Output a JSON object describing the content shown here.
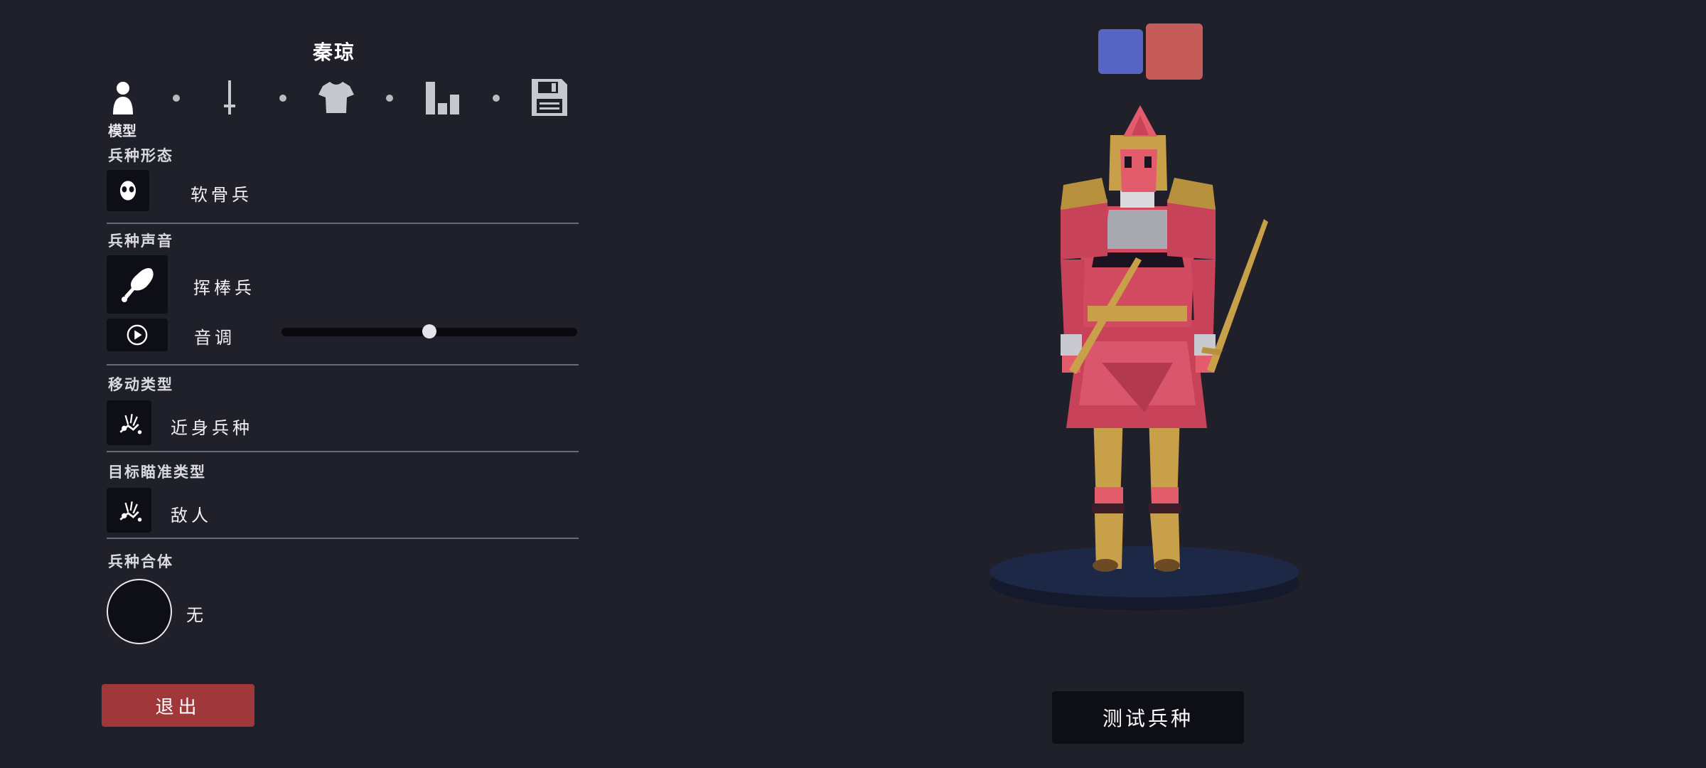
{
  "unit_name": "秦琼",
  "tabs": {
    "items": [
      {
        "name": "model",
        "icon": "person-icon",
        "active": true
      },
      {
        "name": "weapons",
        "icon": "sword-icon",
        "active": false
      },
      {
        "name": "clothing",
        "icon": "shirt-icon",
        "active": false
      },
      {
        "name": "stats",
        "icon": "bar-chart-icon",
        "active": false
      },
      {
        "name": "save",
        "icon": "floppy-disk-icon",
        "active": false
      }
    ],
    "active_caption": "模型"
  },
  "sections": {
    "unit_form": {
      "title": "兵种形态",
      "value": "软骨兵",
      "icon": "skull-mask-icon"
    },
    "unit_voice": {
      "title": "兵种声音",
      "value": "挥棒兵",
      "icon": "club-icon",
      "pitch_label": "音调",
      "pitch_level": 0.5,
      "play_icon": "play-icon"
    },
    "movement_type": {
      "title": "移动类型",
      "value": "近身兵种",
      "icon": "melee-unit-icon"
    },
    "targeting_type": {
      "title": "目标瞄准类型",
      "value": "敌人",
      "icon": "melee-unit-icon"
    },
    "unit_combine": {
      "title": "兵种合体",
      "value": "无"
    }
  },
  "team_colors": {
    "blue": "#5666c4",
    "red": "#c55c5a"
  },
  "buttons": {
    "exit": "退出",
    "test_unit": "测试兵种"
  },
  "colors": {
    "background": "#20202b",
    "panel_box": "#0e0e16",
    "exit_button": "#a0383b"
  }
}
